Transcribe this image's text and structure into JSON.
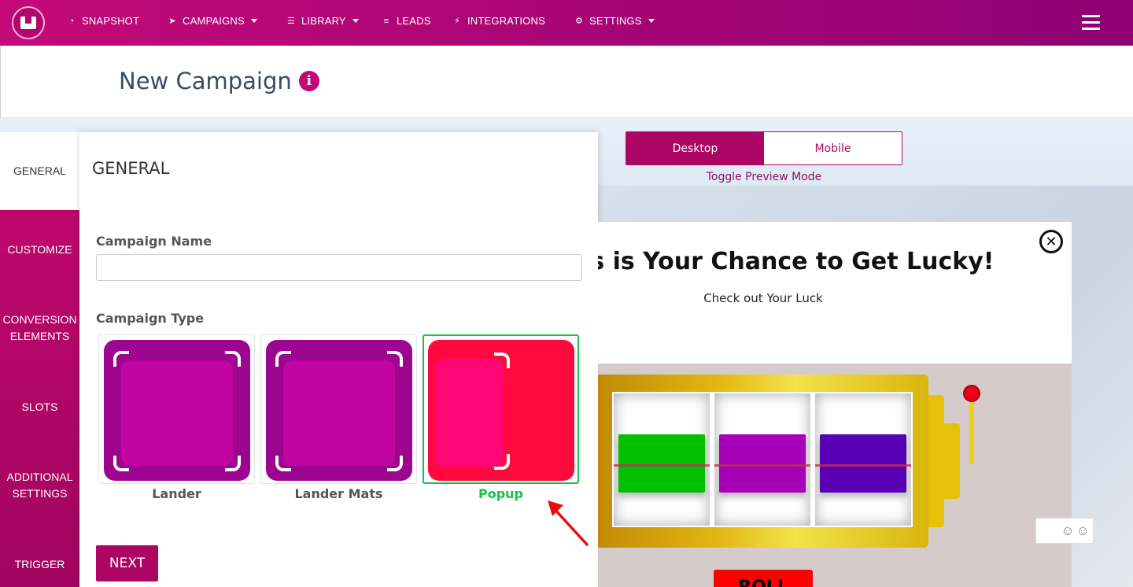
{
  "nav": {
    "items": [
      {
        "label": "SNAPSHOT",
        "icon": "dashboard-icon",
        "glyph": "◔",
        "dropdown": false
      },
      {
        "label": "CAMPAIGNS",
        "icon": "paper-plane-icon",
        "glyph": "➤",
        "dropdown": true
      },
      {
        "label": "LIBRARY",
        "icon": "library-icon",
        "glyph": "☰",
        "dropdown": true
      },
      {
        "label": "LEADS",
        "icon": "list-icon",
        "glyph": "≡",
        "dropdown": false
      },
      {
        "label": "INTEGRATIONS",
        "icon": "plug-icon",
        "glyph": "⚡",
        "dropdown": false
      },
      {
        "label": "SETTINGS",
        "icon": "gears-icon",
        "glyph": "⚙",
        "dropdown": true
      }
    ]
  },
  "page": {
    "title": "New Campaign",
    "info_glyph": "i"
  },
  "sidebar": {
    "items": [
      {
        "label": "GENERAL",
        "active": true
      },
      {
        "label": "CUSTOMIZE",
        "active": false
      },
      {
        "label": "CONVERSION ELEMENTS",
        "active": false
      },
      {
        "label": "SLOTS",
        "active": false
      },
      {
        "label": "ADDITIONAL SETTINGS",
        "active": false
      },
      {
        "label": "TRIGGER",
        "active": false
      }
    ]
  },
  "general": {
    "title": "GENERAL",
    "campaign_name_label": "Campaign Name",
    "campaign_name_value": "",
    "campaign_type_label": "Campaign Type",
    "types": [
      {
        "label": "Lander",
        "selected": false
      },
      {
        "label": "Lander Mats",
        "selected": false
      },
      {
        "label": "Popup",
        "selected": true
      }
    ],
    "next_label": "NEXT"
  },
  "preview": {
    "desktop_label": "Desktop",
    "mobile_label": "Mobile",
    "toggle_hint": "Toggle Preview Mode",
    "popup_title": "is is Your Chance to Get Lucky!",
    "popup_subtitle": "Check out Your Luck",
    "roll_label": "ROLL",
    "reel_colors": [
      "#00c000",
      "#a600b8",
      "#5700b4"
    ]
  },
  "colors": {
    "brand": "#ad0563",
    "selected": "#1bbf4a"
  }
}
